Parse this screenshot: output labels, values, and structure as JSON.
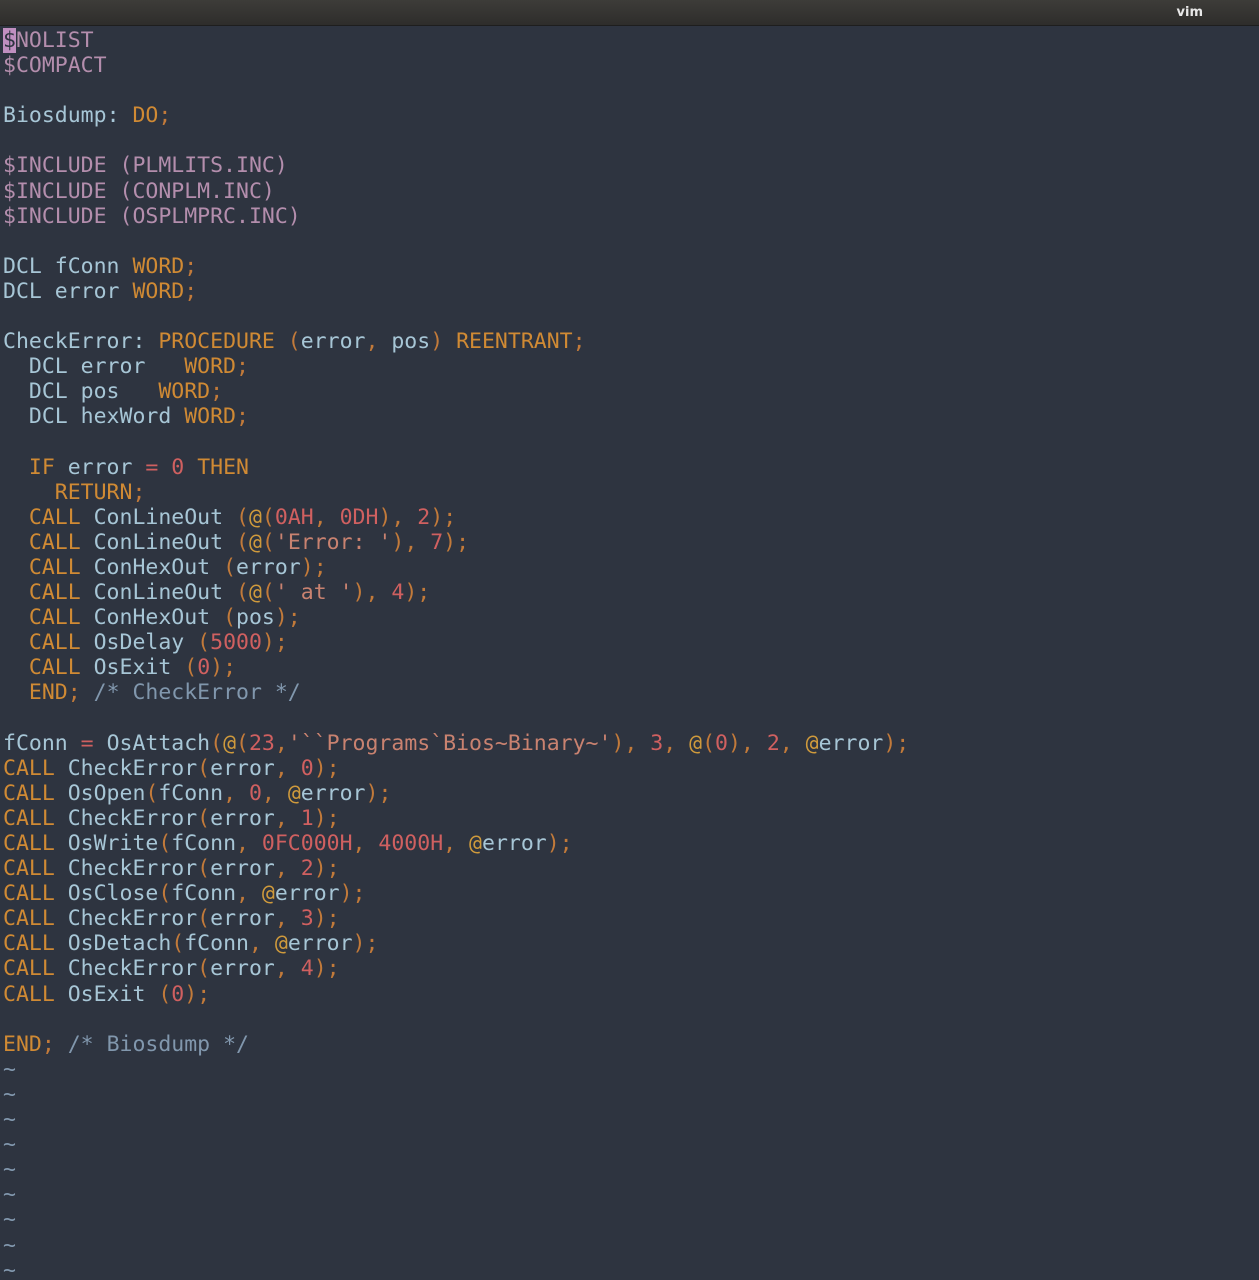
{
  "window": {
    "title": "vim"
  },
  "editor": {
    "lines": [
      [
        {
          "t": "$",
          "c": "cur"
        },
        {
          "t": "NOLIST",
          "c": "pp"
        }
      ],
      [
        {
          "t": "$COMPACT",
          "c": "pp"
        }
      ],
      [],
      [
        {
          "t": "Biosdump",
          "c": "id"
        },
        {
          "t": ": ",
          "c": "id"
        },
        {
          "t": "DO",
          "c": "kw"
        },
        {
          "t": ";",
          "c": "pu"
        }
      ],
      [],
      [
        {
          "t": "$INCLUDE (PLMLITS.INC)",
          "c": "pp"
        }
      ],
      [
        {
          "t": "$INCLUDE (CONPLM.INC)",
          "c": "pp"
        }
      ],
      [
        {
          "t": "$INCLUDE (OSPLMPRC.INC)",
          "c": "pp"
        }
      ],
      [],
      [
        {
          "t": "DCL fConn ",
          "c": "id"
        },
        {
          "t": "WORD",
          "c": "kw"
        },
        {
          "t": ";",
          "c": "pu"
        }
      ],
      [
        {
          "t": "DCL error ",
          "c": "id"
        },
        {
          "t": "WORD",
          "c": "kw"
        },
        {
          "t": ";",
          "c": "pu"
        }
      ],
      [],
      [
        {
          "t": "CheckError: ",
          "c": "id"
        },
        {
          "t": "PROCEDURE",
          "c": "kw"
        },
        {
          "t": " (",
          "c": "pu"
        },
        {
          "t": "error",
          "c": "id"
        },
        {
          "t": ", ",
          "c": "pu"
        },
        {
          "t": "pos",
          "c": "id"
        },
        {
          "t": ") ",
          "c": "pu"
        },
        {
          "t": "REENTRANT",
          "c": "kw"
        },
        {
          "t": ";",
          "c": "pu"
        }
      ],
      [
        {
          "t": "  DCL error   ",
          "c": "id"
        },
        {
          "t": "WORD",
          "c": "kw"
        },
        {
          "t": ";",
          "c": "pu"
        }
      ],
      [
        {
          "t": "  DCL pos   ",
          "c": "id"
        },
        {
          "t": "WORD",
          "c": "kw"
        },
        {
          "t": ";",
          "c": "pu"
        }
      ],
      [
        {
          "t": "  DCL hexWord ",
          "c": "id"
        },
        {
          "t": "WORD",
          "c": "kw"
        },
        {
          "t": ";",
          "c": "pu"
        }
      ],
      [],
      [
        {
          "t": "  ",
          "c": "id"
        },
        {
          "t": "IF",
          "c": "kw"
        },
        {
          "t": " error ",
          "c": "id"
        },
        {
          "t": "=",
          "c": "op"
        },
        {
          "t": " ",
          "c": "id"
        },
        {
          "t": "0",
          "c": "nu"
        },
        {
          "t": " ",
          "c": "id"
        },
        {
          "t": "THEN",
          "c": "kw"
        }
      ],
      [
        {
          "t": "    ",
          "c": "id"
        },
        {
          "t": "RETURN",
          "c": "kw"
        },
        {
          "t": ";",
          "c": "pu"
        }
      ],
      [
        {
          "t": "  ",
          "c": "id"
        },
        {
          "t": "CALL",
          "c": "kw"
        },
        {
          "t": " ConLineOut ",
          "c": "id"
        },
        {
          "t": "(",
          "c": "pu"
        },
        {
          "t": "@",
          "c": "at"
        },
        {
          "t": "(",
          "c": "pu"
        },
        {
          "t": "0AH",
          "c": "nu"
        },
        {
          "t": ", ",
          "c": "pu"
        },
        {
          "t": "0DH",
          "c": "nu"
        },
        {
          "t": "), ",
          "c": "pu"
        },
        {
          "t": "2",
          "c": "nu"
        },
        {
          "t": ");",
          "c": "pu"
        }
      ],
      [
        {
          "t": "  ",
          "c": "id"
        },
        {
          "t": "CALL",
          "c": "kw"
        },
        {
          "t": " ConLineOut ",
          "c": "id"
        },
        {
          "t": "(",
          "c": "pu"
        },
        {
          "t": "@",
          "c": "at"
        },
        {
          "t": "(",
          "c": "pu"
        },
        {
          "t": "'Error: '",
          "c": "st"
        },
        {
          "t": "), ",
          "c": "pu"
        },
        {
          "t": "7",
          "c": "nu"
        },
        {
          "t": ");",
          "c": "pu"
        }
      ],
      [
        {
          "t": "  ",
          "c": "id"
        },
        {
          "t": "CALL",
          "c": "kw"
        },
        {
          "t": " ConHexOut ",
          "c": "id"
        },
        {
          "t": "(",
          "c": "pu"
        },
        {
          "t": "error",
          "c": "id"
        },
        {
          "t": ");",
          "c": "pu"
        }
      ],
      [
        {
          "t": "  ",
          "c": "id"
        },
        {
          "t": "CALL",
          "c": "kw"
        },
        {
          "t": " ConLineOut ",
          "c": "id"
        },
        {
          "t": "(",
          "c": "pu"
        },
        {
          "t": "@",
          "c": "at"
        },
        {
          "t": "(",
          "c": "pu"
        },
        {
          "t": "' at '",
          "c": "st"
        },
        {
          "t": "), ",
          "c": "pu"
        },
        {
          "t": "4",
          "c": "nu"
        },
        {
          "t": ");",
          "c": "pu"
        }
      ],
      [
        {
          "t": "  ",
          "c": "id"
        },
        {
          "t": "CALL",
          "c": "kw"
        },
        {
          "t": " ConHexOut ",
          "c": "id"
        },
        {
          "t": "(",
          "c": "pu"
        },
        {
          "t": "pos",
          "c": "id"
        },
        {
          "t": ");",
          "c": "pu"
        }
      ],
      [
        {
          "t": "  ",
          "c": "id"
        },
        {
          "t": "CALL",
          "c": "kw"
        },
        {
          "t": " OsDelay ",
          "c": "id"
        },
        {
          "t": "(",
          "c": "pu"
        },
        {
          "t": "5000",
          "c": "nu"
        },
        {
          "t": ");",
          "c": "pu"
        }
      ],
      [
        {
          "t": "  ",
          "c": "id"
        },
        {
          "t": "CALL",
          "c": "kw"
        },
        {
          "t": " OsExit ",
          "c": "id"
        },
        {
          "t": "(",
          "c": "pu"
        },
        {
          "t": "0",
          "c": "nu"
        },
        {
          "t": ");",
          "c": "pu"
        }
      ],
      [
        {
          "t": "  ",
          "c": "id"
        },
        {
          "t": "END",
          "c": "kw"
        },
        {
          "t": "; ",
          "c": "pu"
        },
        {
          "t": "/* CheckError */",
          "c": "cm"
        }
      ],
      [],
      [
        {
          "t": "fConn ",
          "c": "id"
        },
        {
          "t": "=",
          "c": "op"
        },
        {
          "t": " OsAttach",
          "c": "id"
        },
        {
          "t": "(",
          "c": "pu"
        },
        {
          "t": "@",
          "c": "at"
        },
        {
          "t": "(",
          "c": "pu"
        },
        {
          "t": "23",
          "c": "nu"
        },
        {
          "t": ",",
          "c": "pu"
        },
        {
          "t": "'``Programs`Bios~Binary~'",
          "c": "st"
        },
        {
          "t": "), ",
          "c": "pu"
        },
        {
          "t": "3",
          "c": "nu"
        },
        {
          "t": ", ",
          "c": "pu"
        },
        {
          "t": "@",
          "c": "at"
        },
        {
          "t": "(",
          "c": "pu"
        },
        {
          "t": "0",
          "c": "nu"
        },
        {
          "t": "), ",
          "c": "pu"
        },
        {
          "t": "2",
          "c": "nu"
        },
        {
          "t": ", ",
          "c": "pu"
        },
        {
          "t": "@",
          "c": "at"
        },
        {
          "t": "error",
          "c": "id"
        },
        {
          "t": ");",
          "c": "pu"
        }
      ],
      [
        {
          "t": "CALL",
          "c": "kw"
        },
        {
          "t": " CheckError",
          "c": "id"
        },
        {
          "t": "(",
          "c": "pu"
        },
        {
          "t": "error",
          "c": "id"
        },
        {
          "t": ", ",
          "c": "pu"
        },
        {
          "t": "0",
          "c": "nu"
        },
        {
          "t": ");",
          "c": "pu"
        }
      ],
      [
        {
          "t": "CALL",
          "c": "kw"
        },
        {
          "t": " OsOpen",
          "c": "id"
        },
        {
          "t": "(",
          "c": "pu"
        },
        {
          "t": "fConn",
          "c": "id"
        },
        {
          "t": ", ",
          "c": "pu"
        },
        {
          "t": "0",
          "c": "nu"
        },
        {
          "t": ", ",
          "c": "pu"
        },
        {
          "t": "@",
          "c": "at"
        },
        {
          "t": "error",
          "c": "id"
        },
        {
          "t": ");",
          "c": "pu"
        }
      ],
      [
        {
          "t": "CALL",
          "c": "kw"
        },
        {
          "t": " CheckError",
          "c": "id"
        },
        {
          "t": "(",
          "c": "pu"
        },
        {
          "t": "error",
          "c": "id"
        },
        {
          "t": ", ",
          "c": "pu"
        },
        {
          "t": "1",
          "c": "nu"
        },
        {
          "t": ");",
          "c": "pu"
        }
      ],
      [
        {
          "t": "CALL",
          "c": "kw"
        },
        {
          "t": " OsWrite",
          "c": "id"
        },
        {
          "t": "(",
          "c": "pu"
        },
        {
          "t": "fConn",
          "c": "id"
        },
        {
          "t": ", ",
          "c": "pu"
        },
        {
          "t": "0FC000H",
          "c": "nu"
        },
        {
          "t": ", ",
          "c": "pu"
        },
        {
          "t": "4000H",
          "c": "nu"
        },
        {
          "t": ", ",
          "c": "pu"
        },
        {
          "t": "@",
          "c": "at"
        },
        {
          "t": "error",
          "c": "id"
        },
        {
          "t": ");",
          "c": "pu"
        }
      ],
      [
        {
          "t": "CALL",
          "c": "kw"
        },
        {
          "t": " CheckError",
          "c": "id"
        },
        {
          "t": "(",
          "c": "pu"
        },
        {
          "t": "error",
          "c": "id"
        },
        {
          "t": ", ",
          "c": "pu"
        },
        {
          "t": "2",
          "c": "nu"
        },
        {
          "t": ");",
          "c": "pu"
        }
      ],
      [
        {
          "t": "CALL",
          "c": "kw"
        },
        {
          "t": " OsClose",
          "c": "id"
        },
        {
          "t": "(",
          "c": "pu"
        },
        {
          "t": "fConn",
          "c": "id"
        },
        {
          "t": ", ",
          "c": "pu"
        },
        {
          "t": "@",
          "c": "at"
        },
        {
          "t": "error",
          "c": "id"
        },
        {
          "t": ");",
          "c": "pu"
        }
      ],
      [
        {
          "t": "CALL",
          "c": "kw"
        },
        {
          "t": " CheckError",
          "c": "id"
        },
        {
          "t": "(",
          "c": "pu"
        },
        {
          "t": "error",
          "c": "id"
        },
        {
          "t": ", ",
          "c": "pu"
        },
        {
          "t": "3",
          "c": "nu"
        },
        {
          "t": ");",
          "c": "pu"
        }
      ],
      [
        {
          "t": "CALL",
          "c": "kw"
        },
        {
          "t": " OsDetach",
          "c": "id"
        },
        {
          "t": "(",
          "c": "pu"
        },
        {
          "t": "fConn",
          "c": "id"
        },
        {
          "t": ", ",
          "c": "pu"
        },
        {
          "t": "@",
          "c": "at"
        },
        {
          "t": "error",
          "c": "id"
        },
        {
          "t": ");",
          "c": "pu"
        }
      ],
      [
        {
          "t": "CALL",
          "c": "kw"
        },
        {
          "t": " CheckError",
          "c": "id"
        },
        {
          "t": "(",
          "c": "pu"
        },
        {
          "t": "error",
          "c": "id"
        },
        {
          "t": ", ",
          "c": "pu"
        },
        {
          "t": "4",
          "c": "nu"
        },
        {
          "t": ");",
          "c": "pu"
        }
      ],
      [
        {
          "t": "CALL",
          "c": "kw"
        },
        {
          "t": " OsExit ",
          "c": "id"
        },
        {
          "t": "(",
          "c": "pu"
        },
        {
          "t": "0",
          "c": "nu"
        },
        {
          "t": ");",
          "c": "pu"
        }
      ],
      [],
      [
        {
          "t": "END",
          "c": "kw"
        },
        {
          "t": "; ",
          "c": "pu"
        },
        {
          "t": "/* Biosdump */",
          "c": "cm"
        }
      ],
      [
        {
          "t": "~",
          "c": "tl"
        }
      ],
      [
        {
          "t": "~",
          "c": "tl"
        }
      ],
      [
        {
          "t": "~",
          "c": "tl"
        }
      ],
      [
        {
          "t": "~",
          "c": "tl"
        }
      ],
      [
        {
          "t": "~",
          "c": "tl"
        }
      ],
      [
        {
          "t": "~",
          "c": "tl"
        }
      ],
      [
        {
          "t": "~",
          "c": "tl"
        }
      ],
      [
        {
          "t": "~",
          "c": "tl"
        }
      ],
      [
        {
          "t": "~",
          "c": "tl"
        }
      ]
    ]
  }
}
